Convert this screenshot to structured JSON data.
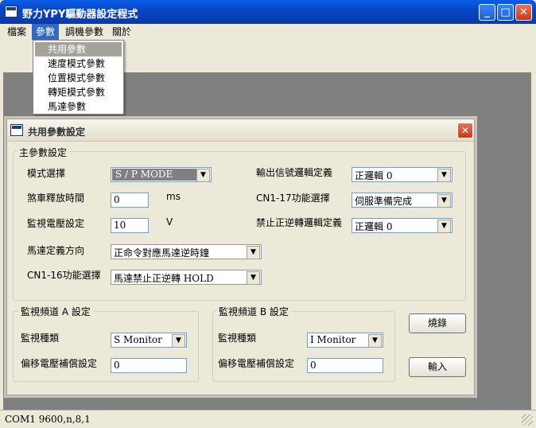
{
  "window": {
    "title": "野力YPY驅動器設定程式",
    "icon": "app-window-icon",
    "controls": {
      "minimize": "_",
      "maximize": "□",
      "close": "✕"
    }
  },
  "menubar": {
    "items": [
      "檔案",
      "參數",
      "調機參數",
      "關於"
    ],
    "active_index": 1
  },
  "dropdown": {
    "items": [
      "共用參數",
      "速度模式參數",
      "位置模式參數",
      "轉矩模式參數",
      "馬達參數"
    ],
    "highlighted_index": 0
  },
  "dialog": {
    "title": "共用參數設定",
    "close_glyph": "✕",
    "main_group": {
      "title": "主參數設定",
      "mode_label": "模式選擇",
      "mode_value": "S / P MODE",
      "brake_label": "煞車釋放時間",
      "brake_value": "0",
      "brake_unit": "ms",
      "voltage_label": "監視電壓設定",
      "voltage_value": "10",
      "voltage_unit": "V",
      "direction_label": "馬達定義方向",
      "direction_value": "正命令對應馬達逆時鐘",
      "cn116_label": "CN1-16功能選擇",
      "cn116_value": "馬達禁止正逆轉 HOLD",
      "output_logic_label": "輸出信號邏輯定義",
      "output_logic_value": "正邏輯 0",
      "cn117_label": "CN1-17功能選擇",
      "cn117_value": "伺服準備完成",
      "forbid_logic_label": "禁止正逆轉邏輯定義",
      "forbid_logic_value": "正邏輯 0"
    },
    "monitor_a": {
      "title": "監視頻道 A 設定",
      "type_label": "監視種類",
      "type_value": "S Monitor",
      "offset_label": "偏移電壓補償設定",
      "offset_value": "0"
    },
    "monitor_b": {
      "title": "監視頻道 B 設定",
      "type_label": "監視種類",
      "type_value": "I Monitor",
      "offset_label": "偏移電壓補償設定",
      "offset_value": "0"
    },
    "burn_button": "燒錄",
    "input_button": "輸入"
  },
  "statusbar": {
    "text": "COM1 9600,n,8,1"
  }
}
